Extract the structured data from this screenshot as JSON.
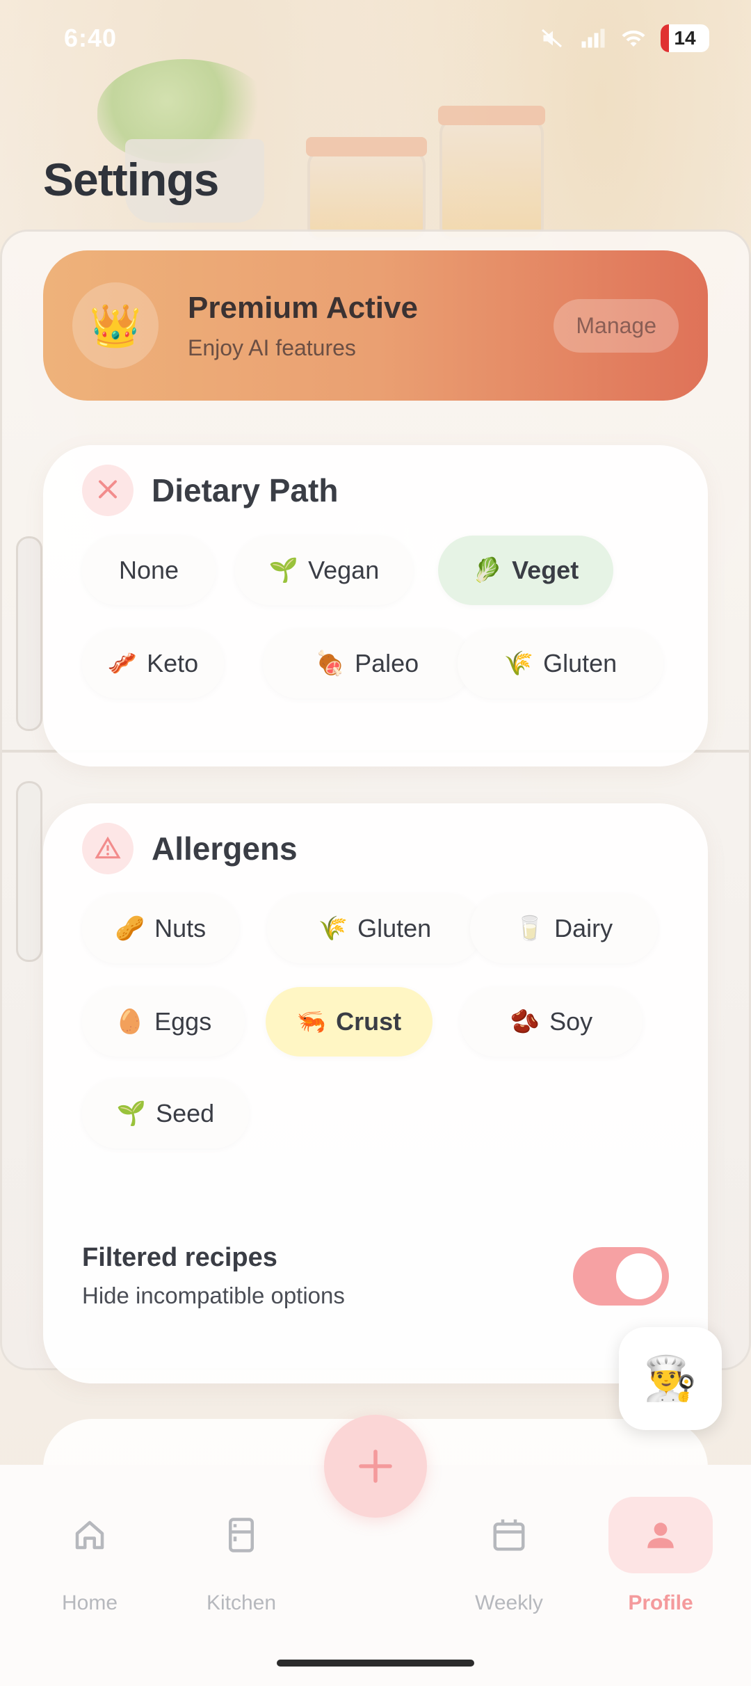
{
  "status_bar": {
    "time": "6:40",
    "battery": "14"
  },
  "page": {
    "title": "Settings"
  },
  "premium": {
    "icon": "crown-icon",
    "title": "Premium Active",
    "subtitle": "Enjoy AI features",
    "manage_label": "Manage"
  },
  "dietary": {
    "title": "Dietary Path",
    "icon": "utensils-icon",
    "options": [
      {
        "label": "None",
        "emoji": "",
        "selected": false
      },
      {
        "label": "Vegan",
        "emoji": "🌱",
        "selected": false
      },
      {
        "label": "Veget",
        "emoji": "🥬",
        "selected": true
      },
      {
        "label": "Keto",
        "emoji": "🥓",
        "selected": false
      },
      {
        "label": "Paleo",
        "emoji": "🍖",
        "selected": false
      },
      {
        "label": "Gluten",
        "emoji": "🌾",
        "selected": false
      }
    ]
  },
  "allergens": {
    "title": "Allergens",
    "icon": "warning-icon",
    "options": [
      {
        "label": "Nuts",
        "emoji": "🥜",
        "selected": false
      },
      {
        "label": "Gluten",
        "emoji": "🌾",
        "selected": false
      },
      {
        "label": "Dairy",
        "emoji": "🥛",
        "selected": false
      },
      {
        "label": "Eggs",
        "emoji": "🥚",
        "selected": false
      },
      {
        "label": "Crust",
        "emoji": "🦐",
        "selected": true
      },
      {
        "label": "Soy",
        "emoji": "🫘",
        "selected": false
      },
      {
        "label": "Seed",
        "emoji": "🌱",
        "selected": false
      }
    ],
    "filter_title": "Filtered recipes",
    "filter_subtitle": "Hide incompatible options",
    "filter_enabled": true
  },
  "chef_button": {
    "icon": "chef-icon",
    "emoji": "👨‍🍳"
  },
  "nav": {
    "items": [
      {
        "label": "Home",
        "icon": "home-icon",
        "active": false
      },
      {
        "label": "Kitchen",
        "icon": "fridge-icon",
        "active": false
      },
      {
        "label": "Weekly",
        "icon": "calendar-icon",
        "active": false
      },
      {
        "label": "Profile",
        "icon": "user-icon",
        "active": true
      }
    ],
    "fab_icon": "plus-icon"
  },
  "colors": {
    "accent": "#f49a9c",
    "premium_start": "#eeb27a",
    "premium_end": "#df7258",
    "selected_green": "#e6f3e5",
    "selected_yellow": "#fff6c4"
  }
}
